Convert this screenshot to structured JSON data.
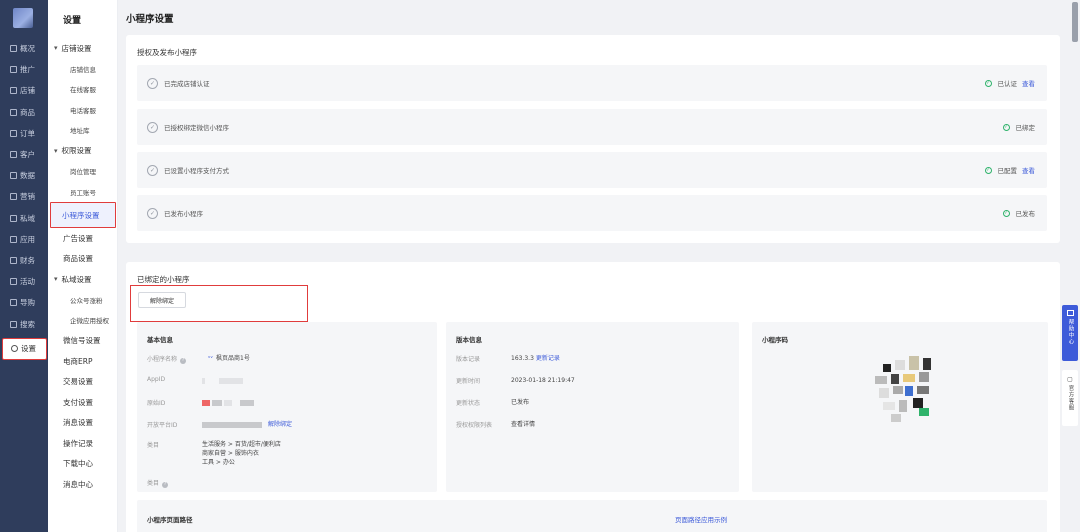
{
  "nav": {
    "items": [
      {
        "label": "概况",
        "icon": "grid-icon"
      },
      {
        "label": "推广",
        "icon": "document-icon"
      },
      {
        "label": "店铺",
        "icon": "store-icon"
      },
      {
        "label": "商品",
        "icon": "goods-icon"
      },
      {
        "label": "订单",
        "icon": "order-icon"
      },
      {
        "label": "客户",
        "icon": "user-icon"
      },
      {
        "label": "数据",
        "icon": "data-icon"
      },
      {
        "label": "营销",
        "icon": "marketing-icon"
      },
      {
        "label": "私域",
        "icon": "private-domain-icon"
      },
      {
        "label": "应用",
        "icon": "apps-icon"
      },
      {
        "label": "财务",
        "icon": "finance-icon"
      },
      {
        "label": "活动",
        "icon": "activity-icon"
      },
      {
        "label": "导购",
        "icon": "guide-icon"
      },
      {
        "label": "搜索",
        "icon": "search-icon"
      }
    ],
    "active": {
      "label": "设置",
      "icon": "gear-icon"
    }
  },
  "sub": {
    "title": "设置",
    "items": [
      {
        "label": "店铺设置",
        "type": "group"
      },
      {
        "label": "店铺信息",
        "type": "child"
      },
      {
        "label": "在线客服",
        "type": "child"
      },
      {
        "label": "电话客服",
        "type": "child"
      },
      {
        "label": "地址库",
        "type": "child"
      },
      {
        "label": "权限设置",
        "type": "group"
      },
      {
        "label": "岗位管理",
        "type": "child"
      },
      {
        "label": "员工账号",
        "type": "child"
      },
      {
        "label": "小程序设置",
        "type": "active"
      },
      {
        "label": "广告设置",
        "type": "item"
      },
      {
        "label": "商品设置",
        "type": "item"
      },
      {
        "label": "私域设置",
        "type": "group"
      },
      {
        "label": "公众号涨粉",
        "type": "child"
      },
      {
        "label": "企微应用授权",
        "type": "child"
      },
      {
        "label": "微信号设置",
        "type": "item"
      },
      {
        "label": "电商ERP",
        "type": "item"
      },
      {
        "label": "交易设置",
        "type": "item"
      },
      {
        "label": "支付设置",
        "type": "item"
      },
      {
        "label": "消息设置",
        "type": "item"
      },
      {
        "label": "操作记录",
        "type": "item"
      },
      {
        "label": "下载中心",
        "type": "item"
      },
      {
        "label": "消息中心",
        "type": "item"
      }
    ]
  },
  "main": {
    "page_title": "小程序设置",
    "auth": {
      "title": "授权及发布小程序",
      "steps": [
        {
          "text": "已完成店铺认证",
          "status": "已认证",
          "link": "查看"
        },
        {
          "text": "已授权绑定微信小程序",
          "status": "已绑定",
          "link": ""
        },
        {
          "text": "已设置小程序支付方式",
          "status": "已配置",
          "link": "查看"
        },
        {
          "text": "已发布小程序",
          "status": "已发布",
          "link": ""
        }
      ]
    },
    "bound": {
      "title": "已绑定的小程序",
      "unbind_button": "解除绑定",
      "basic": {
        "title": "基本信息",
        "name_label": "小程序名称",
        "name_value": "枫页品商1号",
        "appid_label": "AppID",
        "origin_label": "原始ID",
        "open_label": "开放平台ID",
        "open_link": "解除绑定",
        "category_label": "类目",
        "category_lines": [
          "生活服务 > 百货/超市/便利店",
          "商家自营 > 服饰内衣",
          "工具 > 办公"
        ],
        "category2_label": "类目"
      },
      "version": {
        "title": "版本信息",
        "ver_label": "版本记录",
        "ver_value": "163.3.3",
        "ver_link": "更新记录",
        "time_label": "更新时间",
        "time_value": "2023-01-18 21:19:47",
        "state_label": "更新状态",
        "state_value": "已发布",
        "perm_label": "授权权限列表",
        "perm_link": "查看详情"
      },
      "qr": {
        "title": "小程序码"
      },
      "path": {
        "title": "小程序页面路径",
        "link": "页面路径应用示例"
      }
    }
  },
  "float": {
    "help": "帮助中心",
    "cs": "官方客服"
  }
}
